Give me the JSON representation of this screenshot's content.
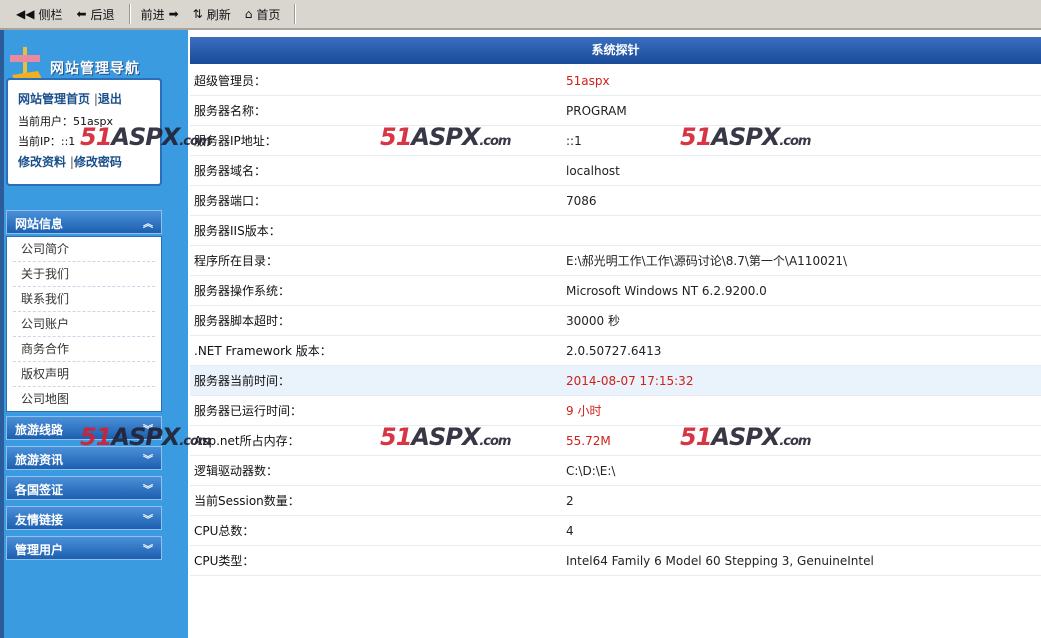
{
  "toolbar": {
    "items": [
      {
        "label": "侧栏",
        "icon": "double-left-icon"
      },
      {
        "label": "后退",
        "icon": "arrow-left-icon"
      },
      {
        "label": "前进",
        "icon": "arrow-right-icon"
      },
      {
        "label": "刷新",
        "icon": "refresh-icon"
      },
      {
        "label": "首页",
        "icon": "home-icon"
      }
    ]
  },
  "sidebar": {
    "title": "网站管理导航",
    "home_link": "网站管理首页",
    "logout": "退出",
    "user_label": "当前用户：",
    "user_value": "51aspx",
    "ip_label": "当前IP：",
    "ip_value": "::1",
    "edit_profile": "修改资料",
    "change_password": "修改密码",
    "sections": [
      {
        "label": "网站信息",
        "expanded": true,
        "items": [
          "公司简介",
          "关于我们",
          "联系我们",
          "公司账户",
          "商务合作",
          "版权声明",
          "公司地图"
        ]
      },
      {
        "label": "旅游线路"
      },
      {
        "label": "旅游资讯"
      },
      {
        "label": "各国签证"
      },
      {
        "label": "友情链接"
      },
      {
        "label": "管理用户"
      }
    ]
  },
  "main": {
    "title": "系统探针",
    "rows": [
      {
        "label": "超级管理员：",
        "value": "51aspx",
        "red": true
      },
      {
        "label": "服务器名称：",
        "value": "PROGRAM"
      },
      {
        "label": "服务器IP地址：",
        "value": "::1"
      },
      {
        "label": "服务器域名：",
        "value": "localhost"
      },
      {
        "label": "服务器端口：",
        "value": "7086"
      },
      {
        "label": "服务器IIS版本：",
        "value": ""
      },
      {
        "label": "程序所在目录：",
        "value": "E:\\郝光明工作\\工作\\源码讨论\\8.7\\第一个\\A110021\\"
      },
      {
        "label": "服务器操作系统：",
        "value": "Microsoft Windows NT 6.2.9200.0"
      },
      {
        "label": "服务器脚本超时：",
        "value": "30000 秒"
      },
      {
        "label": ".NET Framework 版本：",
        "value": "2.0.50727.6413"
      },
      {
        "label": "服务器当前时间：",
        "value": "2014-08-07 17:15:32",
        "red": true,
        "highlight": true
      },
      {
        "label": "服务器已运行时间：",
        "value": "9 小时",
        "red": true
      },
      {
        "label": "Asp.net所占内存：",
        "value": "55.72M",
        "red": true
      },
      {
        "label": "逻辑驱动器数：",
        "value": "C:\\D:\\E:\\"
      },
      {
        "label": "当前Session数量：",
        "value": "2"
      },
      {
        "label": "CPU总数：",
        "value": "4"
      },
      {
        "label": "CPU类型：",
        "value": "Intel64 Family 6 Model 60 Stepping 3, GenuineIntel"
      }
    ]
  },
  "watermark": {
    "a": "51",
    "b": "ASPX",
    "c": ".com"
  }
}
